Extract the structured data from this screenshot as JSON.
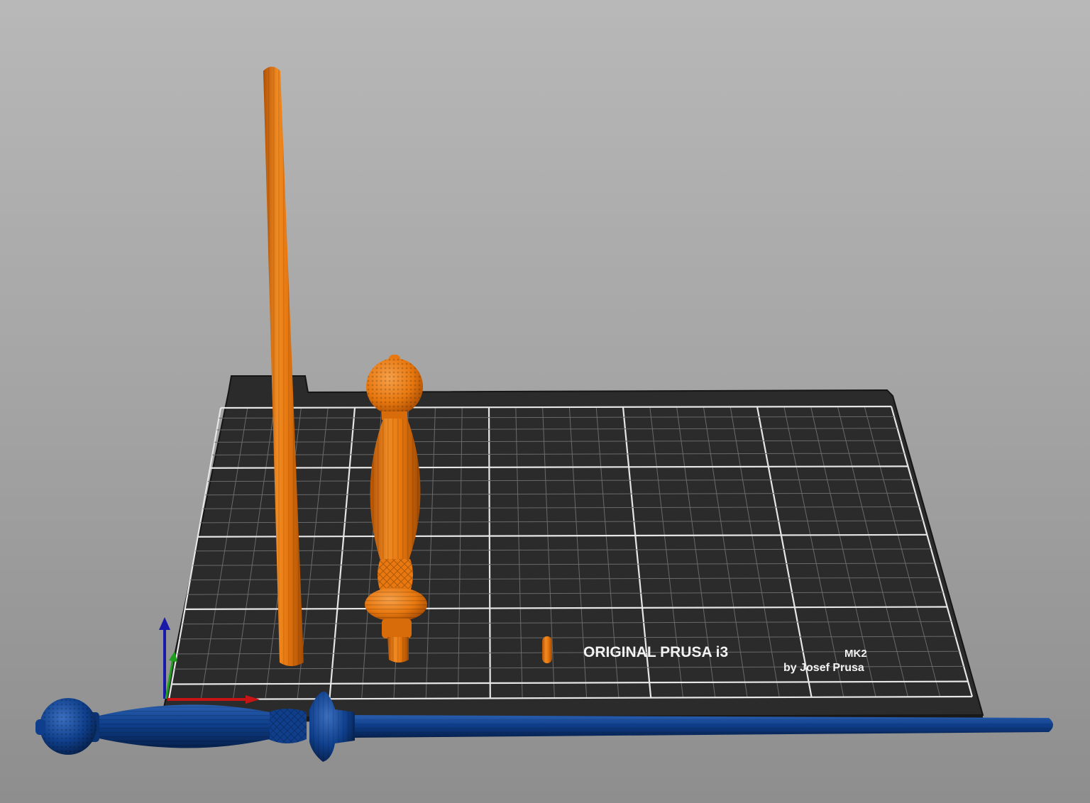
{
  "viewport": {
    "name": "3D view"
  },
  "bed": {
    "brand_line": "ORIGINAL PRUSA i3",
    "model_suffix": "MK2",
    "byline": "by Josef Prusa",
    "colors": {
      "plate": "#2b2b2b",
      "plate_edge": "#1a1a1a",
      "grid_minor": "#6a6a6a",
      "grid_major": "#e6e6e6"
    }
  },
  "objects": {
    "colors": {
      "unselected": "#e8780f",
      "unselected_shade": "#b85706",
      "selected": "#0f3f8c",
      "selected_shade": "#082a60"
    }
  },
  "axes": {
    "colors": {
      "x": "#c81414",
      "y": "#1ea01e",
      "z": "#1a1aa8"
    }
  }
}
